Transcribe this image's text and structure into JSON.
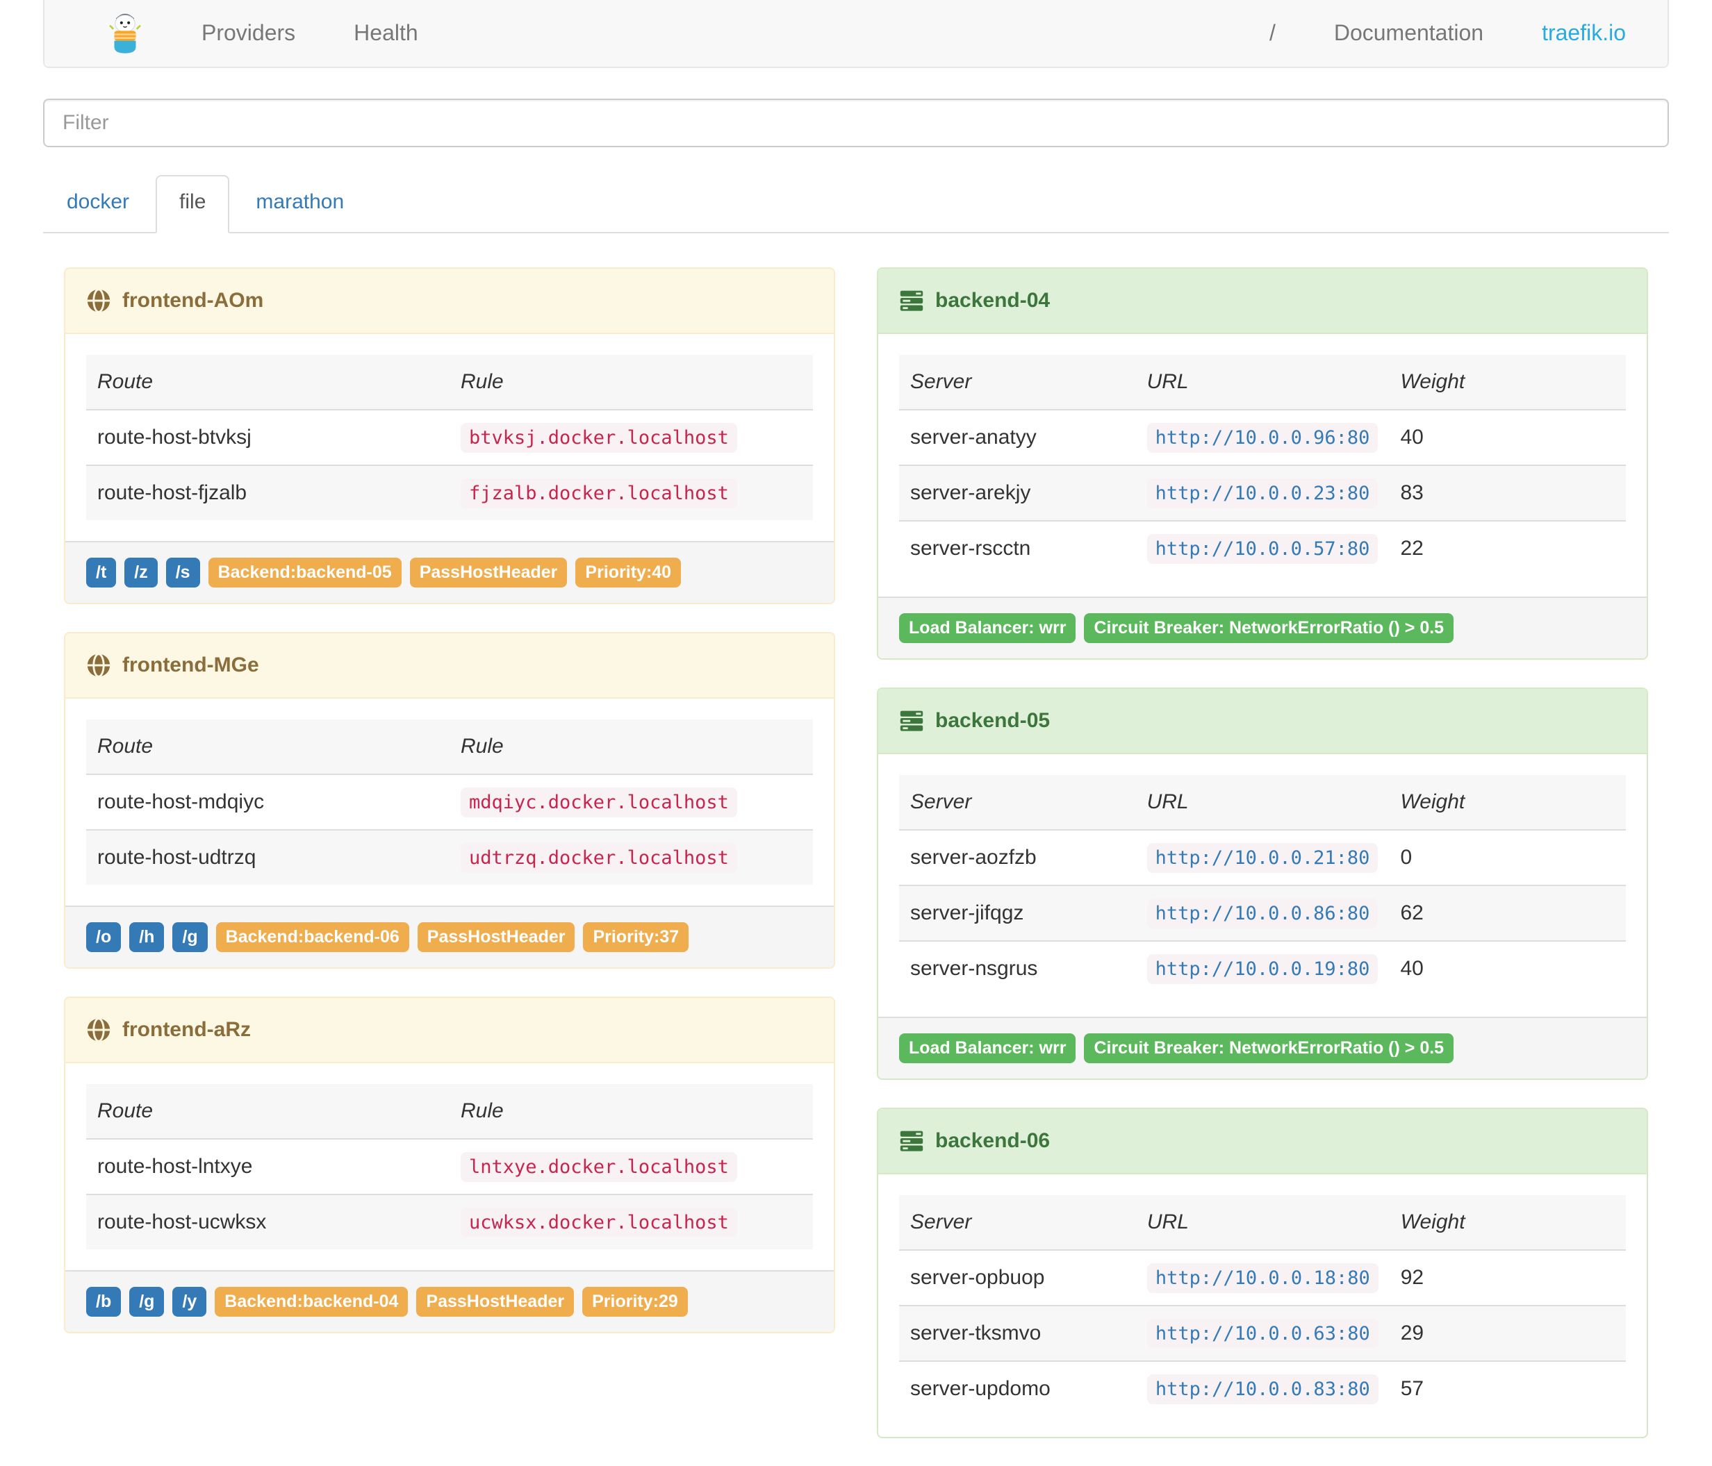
{
  "navbar": {
    "links": [
      {
        "label": "Providers"
      },
      {
        "label": "Health"
      }
    ],
    "divider": "/",
    "documentation_label": "Documentation",
    "site_label": "traefik.io"
  },
  "filter": {
    "placeholder": "Filter",
    "value": ""
  },
  "tabs": [
    {
      "label": "docker",
      "active": false
    },
    {
      "label": "file",
      "active": true
    },
    {
      "label": "marathon",
      "active": false
    }
  ],
  "frontend_table_headers": {
    "route": "Route",
    "rule": "Rule"
  },
  "backend_table_headers": {
    "server": "Server",
    "url": "URL",
    "weight": "Weight"
  },
  "frontends": [
    {
      "name": "frontend-AOm",
      "routes": [
        {
          "route": "route-host-btvksj",
          "rule": "btvksj.docker.localhost"
        },
        {
          "route": "route-host-fjzalb",
          "rule": "fjzalb.docker.localhost"
        }
      ],
      "tags": {
        "paths": [
          "/t",
          "/z",
          "/s"
        ],
        "backend": "Backend:backend-05",
        "pass_host_header": "PassHostHeader",
        "priority": "Priority:40"
      }
    },
    {
      "name": "frontend-MGe",
      "routes": [
        {
          "route": "route-host-mdqiyc",
          "rule": "mdqiyc.docker.localhost"
        },
        {
          "route": "route-host-udtrzq",
          "rule": "udtrzq.docker.localhost"
        }
      ],
      "tags": {
        "paths": [
          "/o",
          "/h",
          "/g"
        ],
        "backend": "Backend:backend-06",
        "pass_host_header": "PassHostHeader",
        "priority": "Priority:37"
      }
    },
    {
      "name": "frontend-aRz",
      "routes": [
        {
          "route": "route-host-lntxye",
          "rule": "lntxye.docker.localhost"
        },
        {
          "route": "route-host-ucwksx",
          "rule": "ucwksx.docker.localhost"
        }
      ],
      "tags": {
        "paths": [
          "/b",
          "/g",
          "/y"
        ],
        "backend": "Backend:backend-04",
        "pass_host_header": "PassHostHeader",
        "priority": "Priority:29"
      }
    }
  ],
  "backends": [
    {
      "name": "backend-04",
      "servers": [
        {
          "server": "server-anatyy",
          "url": "http://10.0.0.96:80",
          "weight": "40"
        },
        {
          "server": "server-arekjy",
          "url": "http://10.0.0.23:80",
          "weight": "83"
        },
        {
          "server": "server-rscctn",
          "url": "http://10.0.0.57:80",
          "weight": "22"
        }
      ],
      "labels": {
        "load_balancer": "Load Balancer: wrr",
        "circuit_breaker": "Circuit Breaker: NetworkErrorRatio () > 0.5"
      }
    },
    {
      "name": "backend-05",
      "servers": [
        {
          "server": "server-aozfzb",
          "url": "http://10.0.0.21:80",
          "weight": "0"
        },
        {
          "server": "server-jifqgz",
          "url": "http://10.0.0.86:80",
          "weight": "62"
        },
        {
          "server": "server-nsgrus",
          "url": "http://10.0.0.19:80",
          "weight": "40"
        }
      ],
      "labels": {
        "load_balancer": "Load Balancer: wrr",
        "circuit_breaker": "Circuit Breaker: NetworkErrorRatio () > 0.5"
      }
    },
    {
      "name": "backend-06",
      "servers": [
        {
          "server": "server-opbuop",
          "url": "http://10.0.0.18:80",
          "weight": "92"
        },
        {
          "server": "server-tksmvo",
          "url": "http://10.0.0.63:80",
          "weight": "29"
        },
        {
          "server": "server-updomo",
          "url": "http://10.0.0.83:80",
          "weight": "57"
        }
      ]
    }
  ],
  "colors": {
    "accent_blue": "#29abe2",
    "tag_blue": "#337ab7",
    "tag_orange": "#f0ad4e",
    "tag_green": "#5cb85c",
    "frontend_header_bg": "#fcf8e3",
    "frontend_text": "#8a6d3b",
    "backend_header_bg": "#dff0d8",
    "backend_text": "#3c763d",
    "rule_code_color": "#c7254e",
    "code_bg": "#f9f2f4"
  }
}
